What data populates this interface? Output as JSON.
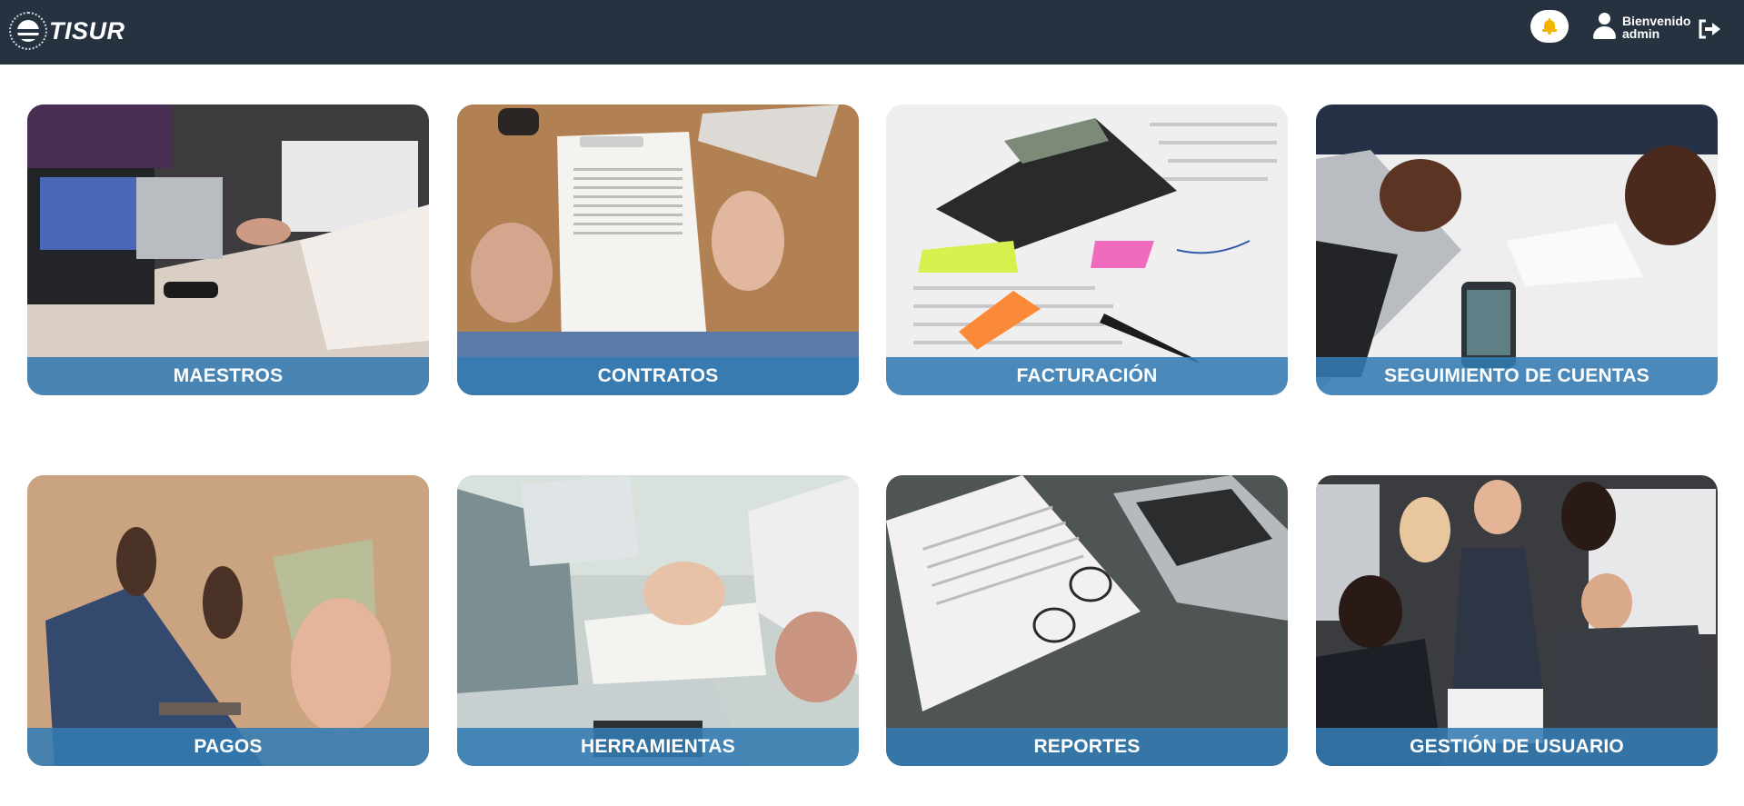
{
  "header": {
    "logo_text": "TISUR",
    "greeting": "Bienvenido",
    "username": "admin",
    "icons": {
      "notifications": "bell-icon",
      "user": "user-icon",
      "logout": "logout-icon"
    },
    "colors": {
      "bar": "#263240",
      "bell": "#f2b600"
    }
  },
  "tiles": [
    {
      "label": "MAESTROS"
    },
    {
      "label": "CONTRATOS"
    },
    {
      "label": "FACTURACIÓN"
    },
    {
      "label": "SEGUIMIENTO DE CUENTAS"
    },
    {
      "label": "PAGOS"
    },
    {
      "label": "HERRAMIENTAS"
    },
    {
      "label": "REPORTES"
    },
    {
      "label": "GESTIÓN DE USUARIO"
    }
  ],
  "tile_label_color": "#337bb2"
}
